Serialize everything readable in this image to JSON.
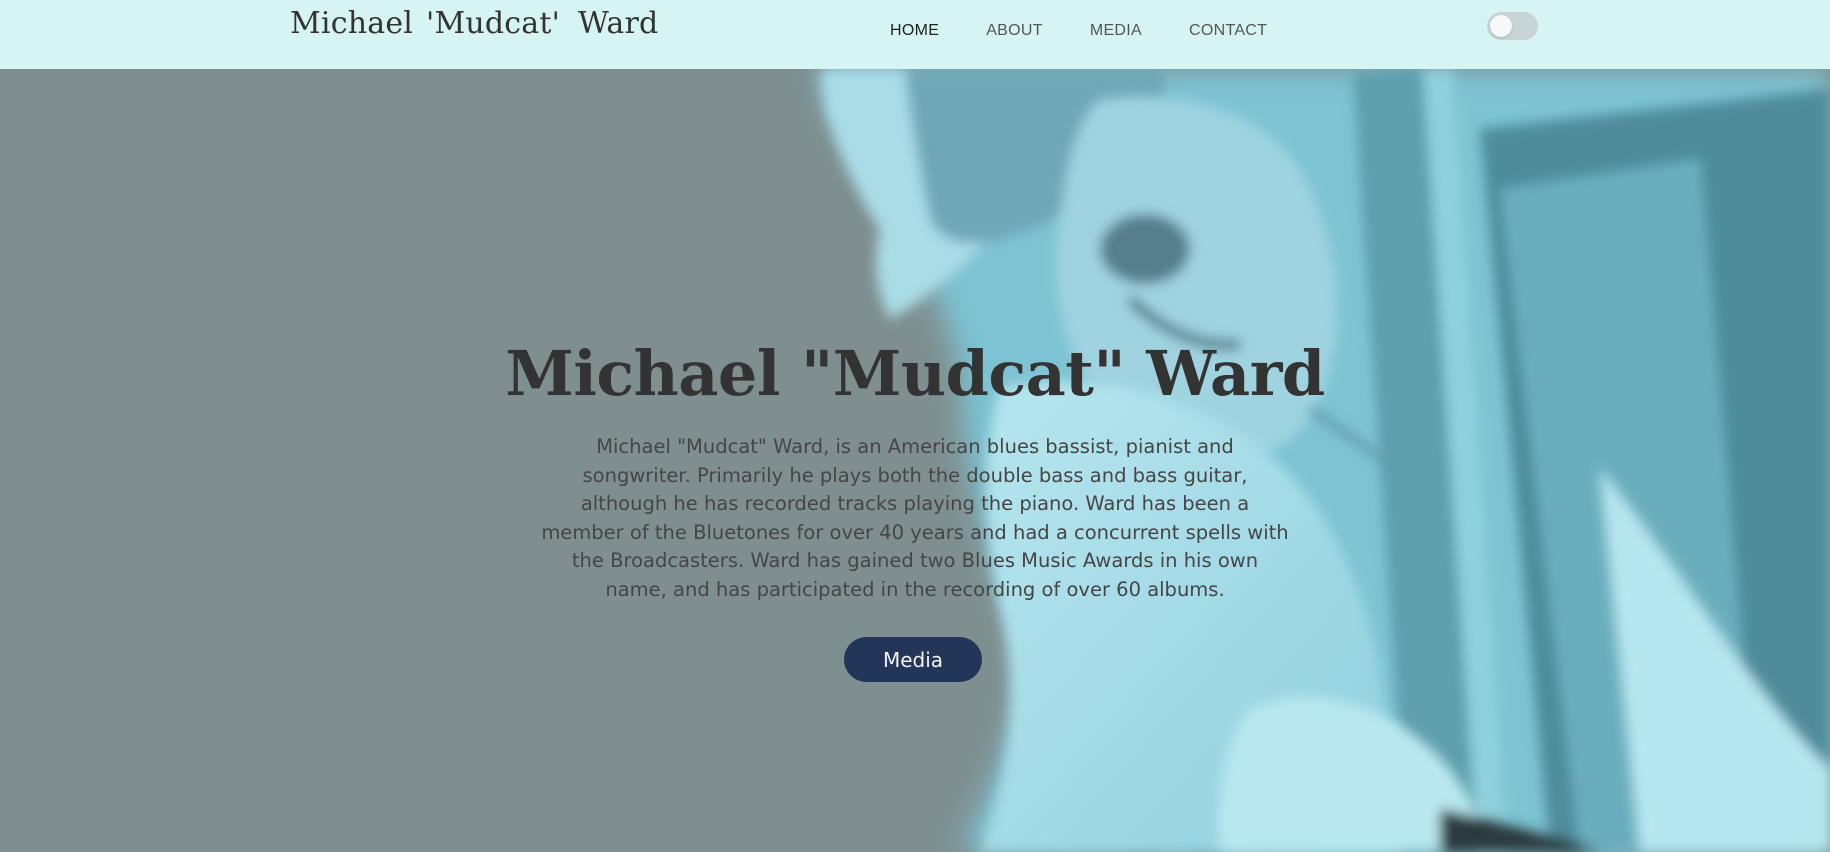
{
  "header": {
    "brand": [
      "Michael",
      "'Mudcat'",
      "Ward"
    ],
    "nav": [
      {
        "label": "HOME",
        "active": true
      },
      {
        "label": "ABOUT",
        "active": false
      },
      {
        "label": "MEDIA",
        "active": false
      },
      {
        "label": "CONTACT",
        "active": false
      }
    ],
    "theme_toggle_on": false
  },
  "hero": {
    "title": "Michael \"Mudcat\" Ward",
    "description": "Michael \"Mudcat\" Ward, is an American blues bassist, pianist and songwriter. Primarily he plays both the double bass and bass guitar, although he has recorded tracks playing the piano. Ward has been a member of the Bluetones for over 40 years and had a concurrent spells with the Broadcasters. Ward has gained two Blues Music Awards in his own name, and has participated in the recording of over 60 albums.",
    "button_label": "Media"
  },
  "colors": {
    "header_bg": "#d6f5f2",
    "hero_overlay": "#7f8f8f",
    "photo_tint": "#7cc4d4",
    "button_bg": "#24355a"
  }
}
